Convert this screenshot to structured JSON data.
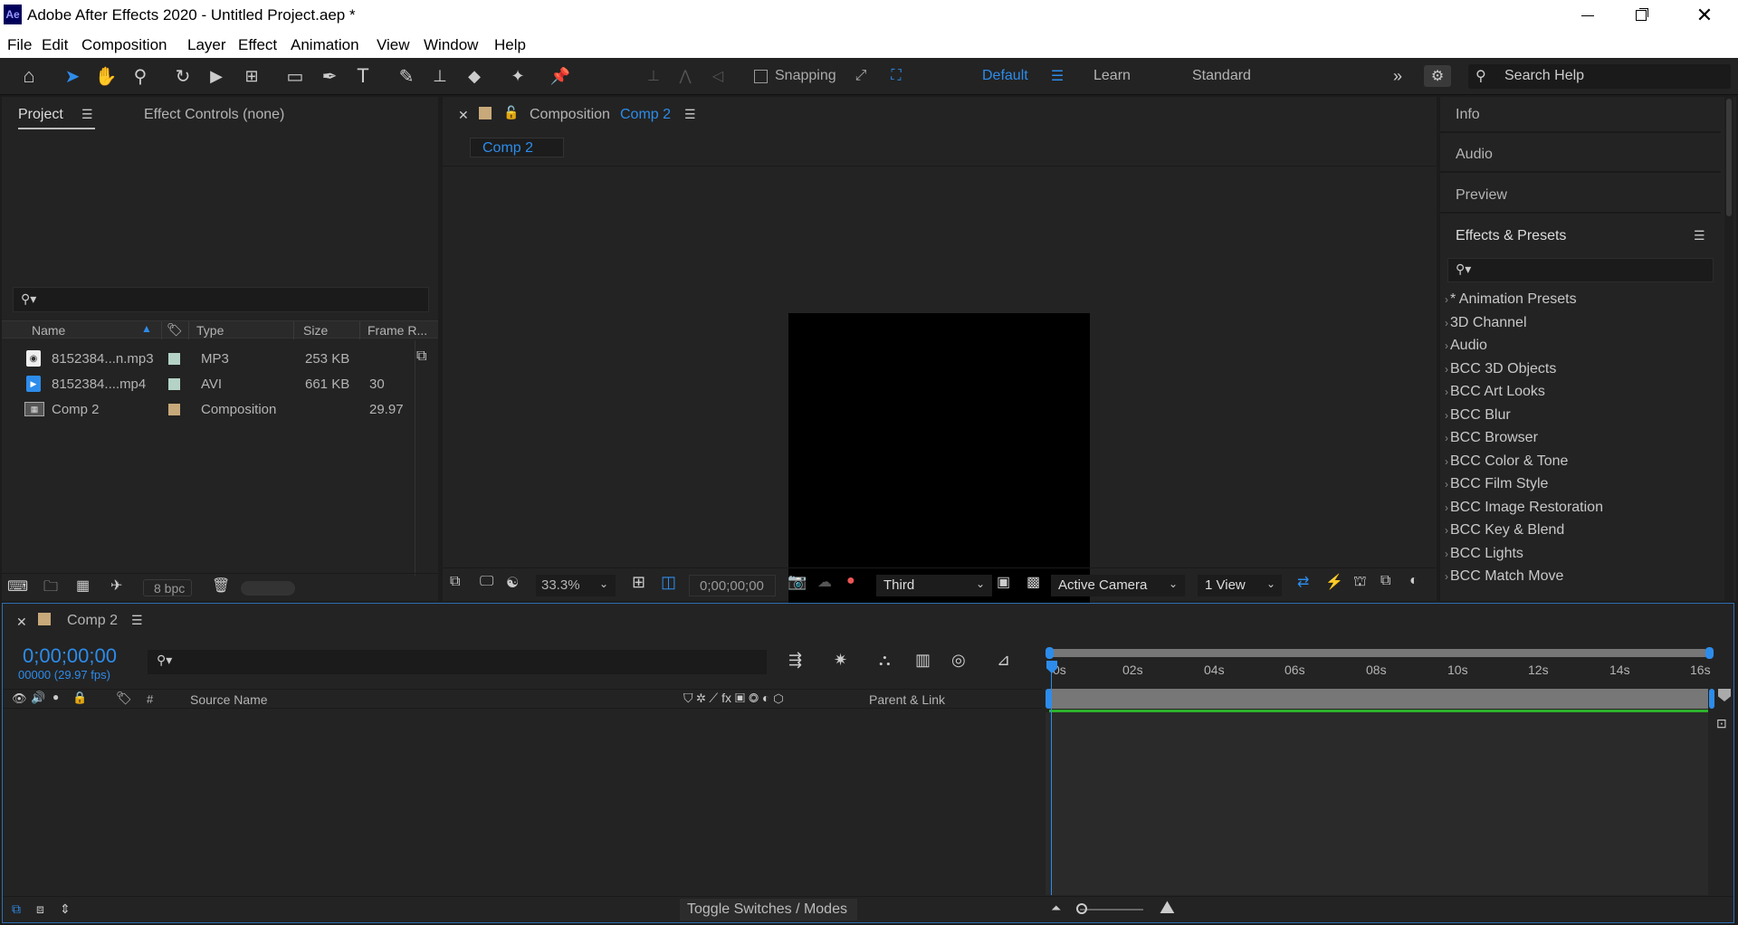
{
  "window": {
    "title": "Adobe After Effects 2020 - Untitled Project.aep *",
    "app_badge": "Ae"
  },
  "menu": [
    "File",
    "Edit",
    "Composition",
    "Layer",
    "Effect",
    "Animation",
    "View",
    "Window",
    "Help"
  ],
  "toolbar": {
    "snapping_label": "Snapping",
    "workspaces": [
      "Default",
      "Learn",
      "Standard"
    ],
    "search_placeholder": "Search Help"
  },
  "project_panel": {
    "tabs": [
      "Project",
      "Effect Controls (none)"
    ],
    "columns": [
      "Name",
      "Type",
      "Size",
      "Frame R..."
    ],
    "items": [
      {
        "name": "8152384...n.mp3",
        "label_color": "#b4d3c6",
        "type": "MP3",
        "size": "253 KB",
        "fps": ""
      },
      {
        "name": "8152384....mp4",
        "label_color": "#b4d3c6",
        "type": "AVI",
        "size": "661 KB",
        "fps": "30"
      },
      {
        "name": "Comp 2",
        "label_color": "#c8a97a",
        "type": "Composition",
        "size": "",
        "fps": "29.97"
      }
    ],
    "bpc": "8 bpc"
  },
  "comp_panel": {
    "tab_prefix": "Composition",
    "tab_name": "Comp 2",
    "subtab": "Comp 2",
    "zoom": "33.3%",
    "timecode": "0;00;00;00",
    "resolution": "Third",
    "camera": "Active Camera",
    "views": "1 View"
  },
  "right_panel": {
    "sections": [
      "Info",
      "Audio",
      "Preview",
      "Effects & Presets"
    ],
    "effects": [
      "* Animation Presets",
      "3D Channel",
      "Audio",
      "BCC 3D Objects",
      "BCC Art Looks",
      "BCC Blur",
      "BCC Browser",
      "BCC Color & Tone",
      "BCC Film Style",
      "BCC Image Restoration",
      "BCC Key & Blend",
      "BCC Lights",
      "BCC Match Move"
    ]
  },
  "timeline": {
    "tab_name": "Comp 2",
    "timecode": "0;00;00;00",
    "frame_info": "00000 (29.97 fps)",
    "columns": [
      "#",
      "Source Name",
      "Parent & Link"
    ],
    "ticks": [
      "0s",
      "02s",
      "04s",
      "06s",
      "08s",
      "10s",
      "12s",
      "14s",
      "16s"
    ],
    "toggle_label": "Toggle Switches / Modes"
  },
  "colors": {
    "accent": "#2d8ceb",
    "panel": "#232323",
    "bg": "#1c1c1c",
    "work_area": "#2cb12c"
  }
}
